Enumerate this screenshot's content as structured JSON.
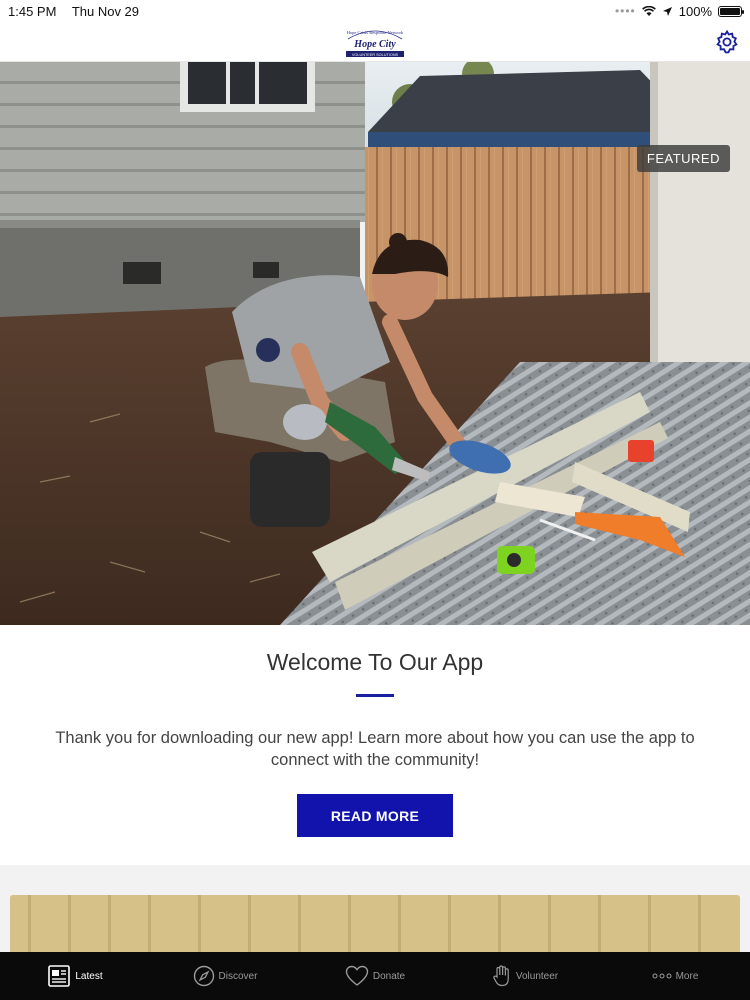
{
  "status_bar": {
    "time": "1:45 PM",
    "date": "Thu Nov 29",
    "battery": "100%"
  },
  "nav": {
    "logo_text_top": "Hope Crisis Response Network",
    "logo_text_main": "Hope City",
    "logo_text_sub": "VOLUNTEER SOLUTIONS"
  },
  "hero": {
    "badge": "FEATURED"
  },
  "welcome": {
    "title": "Welcome To Our App",
    "body": "Thank you for downloading our new app! Learn more about how you can use the app to connect with the community!",
    "button": "READ MORE"
  },
  "tabs": [
    {
      "label": "Latest",
      "icon": "newspaper-icon"
    },
    {
      "label": "Discover",
      "icon": "compass-icon"
    },
    {
      "label": "Donate",
      "icon": "heart-icon"
    },
    {
      "label": "Volunteer",
      "icon": "hand-icon"
    },
    {
      "label": "More",
      "icon": "more-dots-icon"
    }
  ],
  "colors": {
    "accent": "#1212ad",
    "tab_bar": "#0a0a0a",
    "active_tab": "#ffffff"
  }
}
